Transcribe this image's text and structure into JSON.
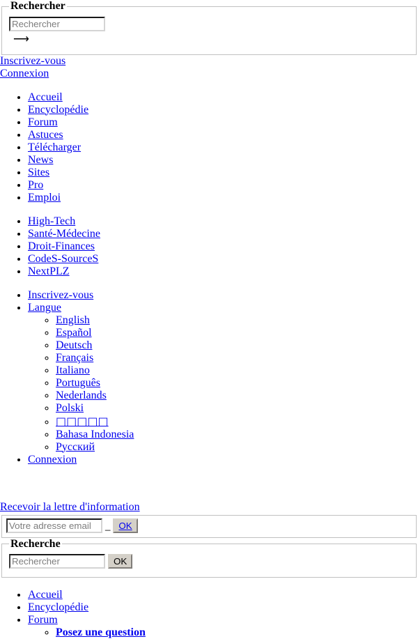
{
  "search_top": {
    "legend": "Rechercher",
    "input_placeholder": "Rechercher",
    "input_value": "",
    "submit_label": "⟶"
  },
  "auth": {
    "register": "Inscrivez-vous",
    "login": "Connexion"
  },
  "main_nav": [
    "Accueil",
    "Encyclopédie",
    "Forum",
    "Astuces",
    "Télécharger",
    "News",
    "Sites",
    "Pro",
    "Emploi"
  ],
  "sites_nav": [
    "High-Tech",
    "Santé-Médecine",
    "Droit-Finances",
    "CodeS-SourceS",
    "NextPLZ"
  ],
  "user_nav": {
    "register": "Inscrivez-vous",
    "language_label": "Langue",
    "languages": [
      "English",
      "Español",
      "Deutsch",
      "Français",
      "Italiano",
      "Português",
      "Nederlands",
      "Polski",
      "□□□□□",
      "Bahasa Indonesia",
      "Русский"
    ],
    "login": "Connexion"
  },
  "newsletter": {
    "title": "Recevoir la lettre d'information",
    "input_placeholder": "Votre adresse email",
    "input_value": "",
    "separator": "_",
    "submit_label": "OK"
  },
  "search_bottom": {
    "legend": "Recherche",
    "input_placeholder": "Rechercher",
    "input_value": "",
    "submit_label": "OK"
  },
  "footer_nav": {
    "items": [
      "Accueil",
      "Encyclopédie",
      "Forum"
    ],
    "forum_sub": "Posez une question"
  },
  "colors": {
    "link": "#0000ee",
    "border": "#c0c0c0",
    "button_face": "#d4d0c8",
    "placeholder": "#7d7d7d"
  }
}
